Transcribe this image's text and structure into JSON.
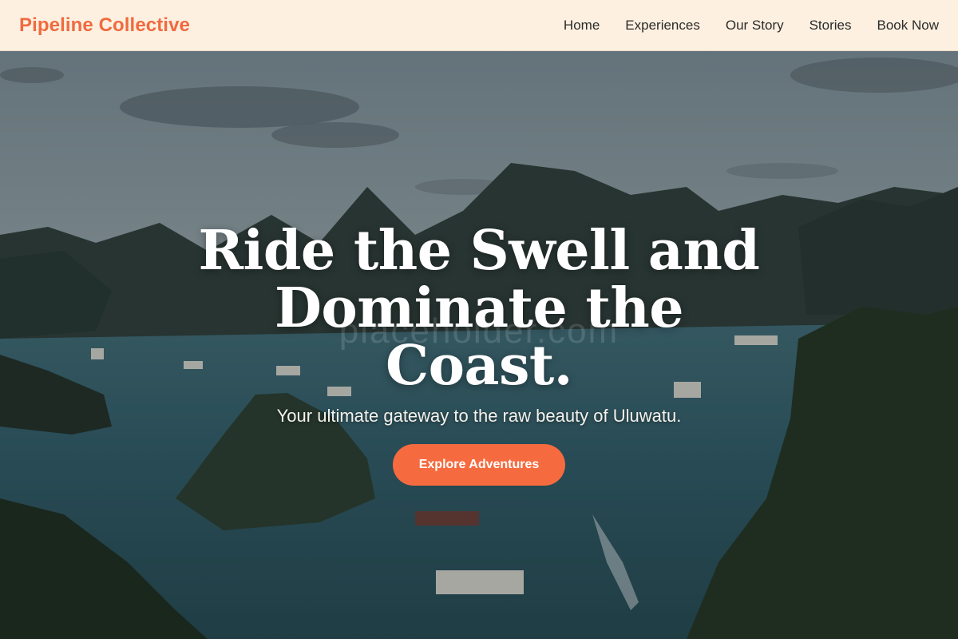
{
  "nav": {
    "brand": "Pipeline Collective",
    "links": [
      "Home",
      "Experiences",
      "Our Story",
      "Stories",
      "Book Now"
    ]
  },
  "hero": {
    "title": "Ride the Swell and Dominate the Coast.",
    "subtitle": "Your ultimate gateway to the raw beauty of Uluwatu.",
    "cta_label": "Explore Adventures",
    "watermark": "placeholder.com"
  },
  "colors": {
    "accent": "#f56b3f",
    "brand": "#f06a3f",
    "nav_bg": "#fdf0e0"
  }
}
